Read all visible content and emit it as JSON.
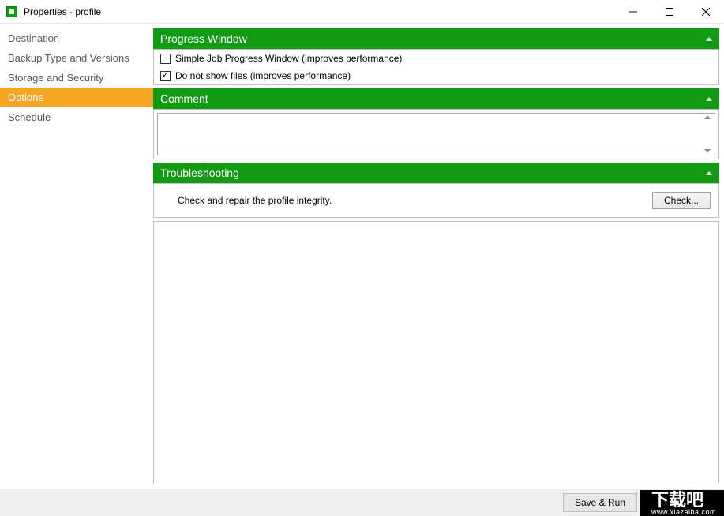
{
  "window": {
    "title": "Properties - profile"
  },
  "sidebar": {
    "items": [
      {
        "label": "Destination",
        "active": false
      },
      {
        "label": "Backup Type and Versions",
        "active": false
      },
      {
        "label": "Storage and Security",
        "active": false
      },
      {
        "label": "Options",
        "active": true
      },
      {
        "label": "Schedule",
        "active": false
      }
    ]
  },
  "sections": {
    "progress": {
      "title": "Progress Window",
      "checkbox1": {
        "label": "Simple Job Progress Window (improves performance)",
        "checked": false
      },
      "checkbox2": {
        "label": "Do not show files (improves performance)",
        "checked": true
      }
    },
    "comment": {
      "title": "Comment",
      "value": ""
    },
    "troubleshoot": {
      "title": "Troubleshooting",
      "text": "Check and repair the profile integrity.",
      "button": "Check..."
    }
  },
  "footer": {
    "save_run": "Save & Run"
  },
  "watermark": {
    "big": "下载吧",
    "small": "www.xiazaiba.com"
  }
}
